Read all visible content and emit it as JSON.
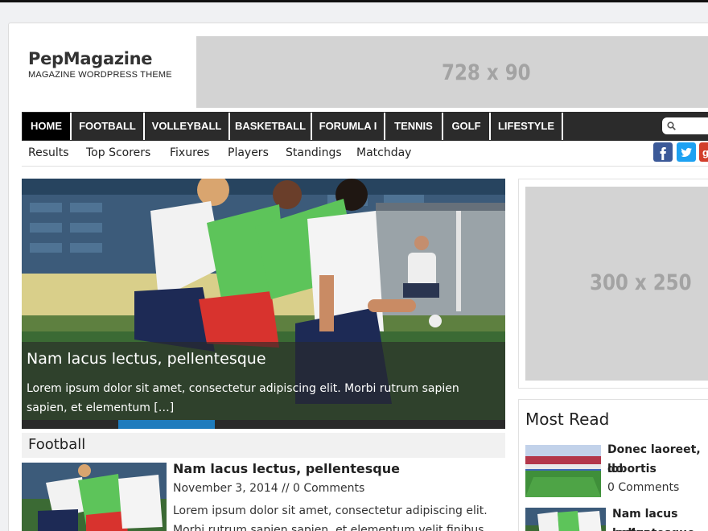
{
  "site": {
    "title": "PepMagazine",
    "tagline": "MAGAZINE WORDPRESS THEME"
  },
  "ads": {
    "top": "728 x 90",
    "side": "300 x 250"
  },
  "nav": {
    "items": [
      "HOME",
      "FOOTBALL",
      "VOLLEYBALL",
      "BASKETBALL",
      "FORUMLA I",
      "TENNIS",
      "GOLF",
      "LIFESTYLE"
    ],
    "active": "HOME",
    "search_icon": "search-icon"
  },
  "subnav": {
    "items": [
      "Results",
      "Top Scorers",
      "Fixures",
      "Players",
      "Standings",
      "Matchday"
    ]
  },
  "social": {
    "facebook": {
      "icon": "facebook-icon",
      "color": "#3b5998"
    },
    "twitter": {
      "icon": "twitter-icon",
      "color": "#1da1f2"
    },
    "googleplus": {
      "icon": "googleplus-icon",
      "color": "#d23e2b"
    }
  },
  "slider": {
    "title": "Nam lacus lectus, pellentesque",
    "excerpt": "Lorem ipsum dolor sit amet, consectetur adipiscing elit. Morbi rutrum sapien sapien, et elementum […]",
    "accent": "#1e7bbd"
  },
  "category": {
    "name": "Football",
    "post": {
      "title": "Nam lacus lectus, pellentesque",
      "meta": "November 3, 2014 // 0 Comments",
      "excerpt": "Lorem ipsum dolor sit amet, consectetur adipiscing elit. Morbi rutrum sapien sapien, et elementum velit finibus"
    }
  },
  "most_read": {
    "heading": "Most Read",
    "items": [
      {
        "title_line1": "Donec laoreet, do",
        "title_line2": "lobortis",
        "meta": "0 Comments"
      },
      {
        "title_line1": "Nam lacus lectus",
        "title_line2": "pellentesque"
      }
    ]
  }
}
